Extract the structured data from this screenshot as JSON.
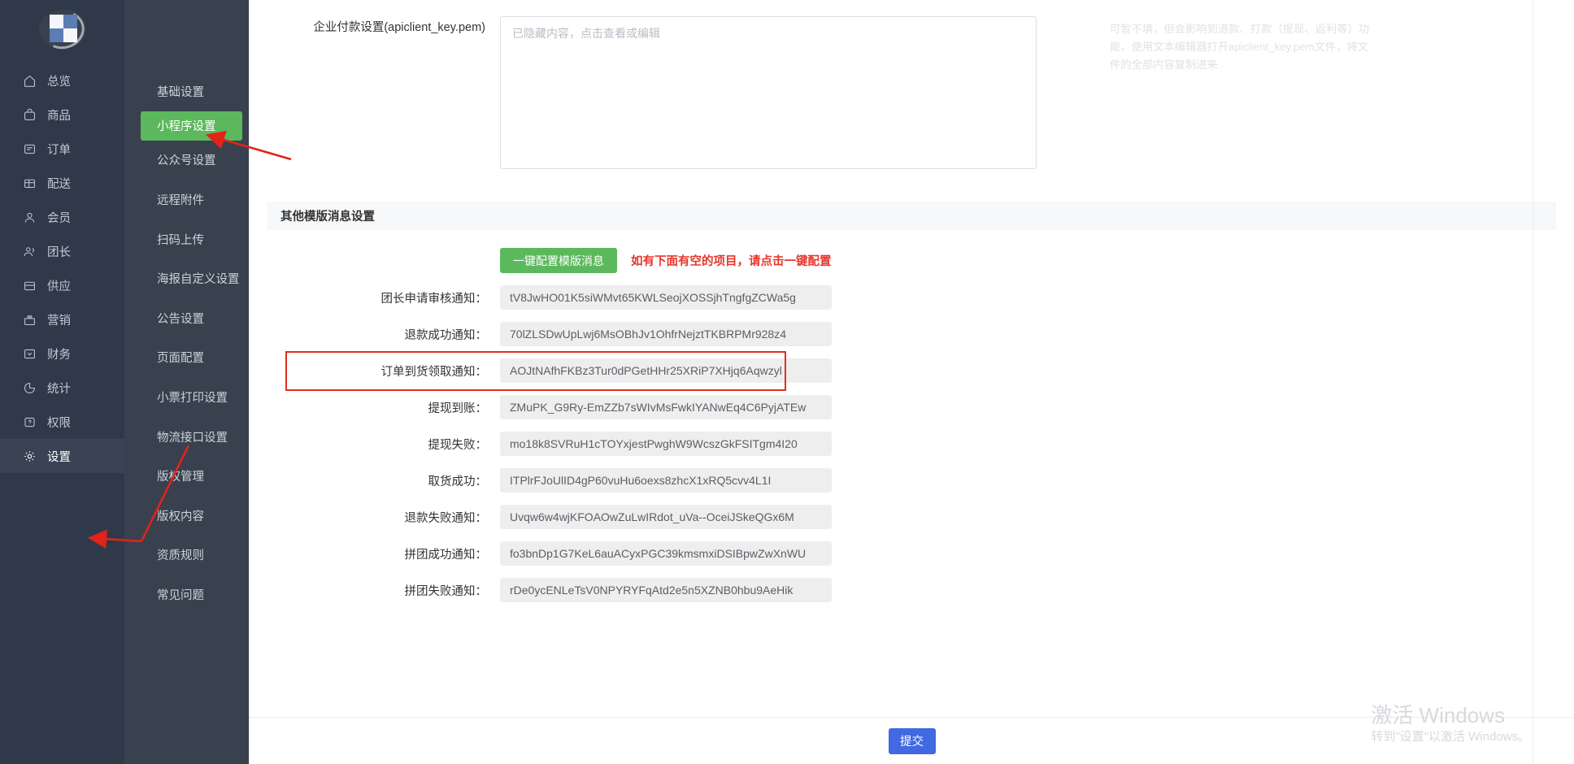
{
  "sidebar": {
    "logo_name": "brand-logo",
    "items": [
      {
        "label": "总览",
        "icon": "home-icon",
        "active": false
      },
      {
        "label": "商品",
        "icon": "bag-icon",
        "active": false
      },
      {
        "label": "订单",
        "icon": "order-icon",
        "active": false
      },
      {
        "label": "配送",
        "icon": "delivery-icon",
        "active": false
      },
      {
        "label": "会员",
        "icon": "user-icon",
        "active": false
      },
      {
        "label": "团长",
        "icon": "group-leader-icon",
        "active": false
      },
      {
        "label": "供应",
        "icon": "supply-icon",
        "active": false
      },
      {
        "label": "营销",
        "icon": "marketing-icon",
        "active": false
      },
      {
        "label": "财务",
        "icon": "finance-icon",
        "active": false
      },
      {
        "label": "统计",
        "icon": "chart-icon",
        "active": false
      },
      {
        "label": "权限",
        "icon": "permission-icon",
        "active": false
      },
      {
        "label": "设置",
        "icon": "gear-icon",
        "active": true
      }
    ]
  },
  "submenu": {
    "items": [
      {
        "label": "基础设置",
        "active": false
      },
      {
        "label": "小程序设置",
        "active": true
      },
      {
        "label": "公众号设置",
        "active": false
      },
      {
        "label": "远程附件",
        "active": false
      },
      {
        "label": "扫码上传",
        "active": false
      },
      {
        "label": "海报自定义设置",
        "active": false
      },
      {
        "label": "公告设置",
        "active": false
      },
      {
        "label": "页面配置",
        "active": false
      },
      {
        "label": "小票打印设置",
        "active": false
      },
      {
        "label": "物流接口设置",
        "active": false
      },
      {
        "label": "版权管理",
        "active": false
      },
      {
        "label": "版权内容",
        "active": false
      },
      {
        "label": "资质规则",
        "active": false
      },
      {
        "label": "常见问题",
        "active": false
      }
    ]
  },
  "pem": {
    "label": "企业付款设置(apiclient_key.pem)",
    "placeholder": "已隐藏内容，点击查看或编辑",
    "value": "",
    "hint": "可暂不填，但会影响到退款、打款（提现、返利等）功能。使用文本编辑器打开apiclient_key.pem文件，将文件的全部内容复制进来"
  },
  "section": {
    "title": "其他模版消息设置",
    "onekey_button": "一键配置模版消息",
    "onekey_note": "如有下面有空的项目，请点击一键配置"
  },
  "fields": [
    {
      "label": "团长申请审核通知：",
      "value": "tV8JwHO01K5siWMvt65KWLSeojXOSSjhTngfgZCWa5g",
      "highlight": false
    },
    {
      "label": "退款成功通知：",
      "value": "70lZLSDwUpLwj6MsOBhJv1OhfrNejztTKBRPMr928z4",
      "highlight": false
    },
    {
      "label": "订单到货领取通知：",
      "value": "AOJtNAfhFKBz3Tur0dPGetHHr25XRiP7XHjq6Aqwzyl",
      "highlight": true
    },
    {
      "label": "提现到账：",
      "value": "ZMuPK_G9Ry-EmZZb7sWIvMsFwkIYANwEq4C6PyjATEw",
      "highlight": false
    },
    {
      "label": "提现失败：",
      "value": "mo18k8SVRuH1cTOYxjestPwghW9WcszGkFSITgm4I20",
      "highlight": false
    },
    {
      "label": "取货成功：",
      "value": "ITPlrFJoUlID4gP60vuHu6oexs8zhcX1xRQ5cvv4L1I",
      "highlight": false
    },
    {
      "label": "退款失败通知：",
      "value": "Uvqw6w4wjKFOAOwZuLwIRdot_uVa--OceiJSkeQGx6M",
      "highlight": false
    },
    {
      "label": "拼团成功通知：",
      "value": "fo3bnDp1G7KeL6auACyxPGC39kmsmxiDSIBpwZwXnWU",
      "highlight": false
    },
    {
      "label": "拼团失败通知：",
      "value": "rDe0ycENLeTsV0NPYRYFqAtd2e5n5XZNB0hbu9AeHik",
      "highlight": false
    }
  ],
  "footer": {
    "submit_label": "提交"
  },
  "watermark": {
    "title": "激活 Windows",
    "subtitle": "转到\"设置\"以激活 Windows。"
  },
  "colors": {
    "sidebar_primary": "#30394a",
    "sidebar_secondary": "#39414f",
    "accent_green": "#5cb85c",
    "accent_red": "#e22d1f",
    "submit_blue": "#4169e1",
    "field_bg": "#eeeeee"
  }
}
